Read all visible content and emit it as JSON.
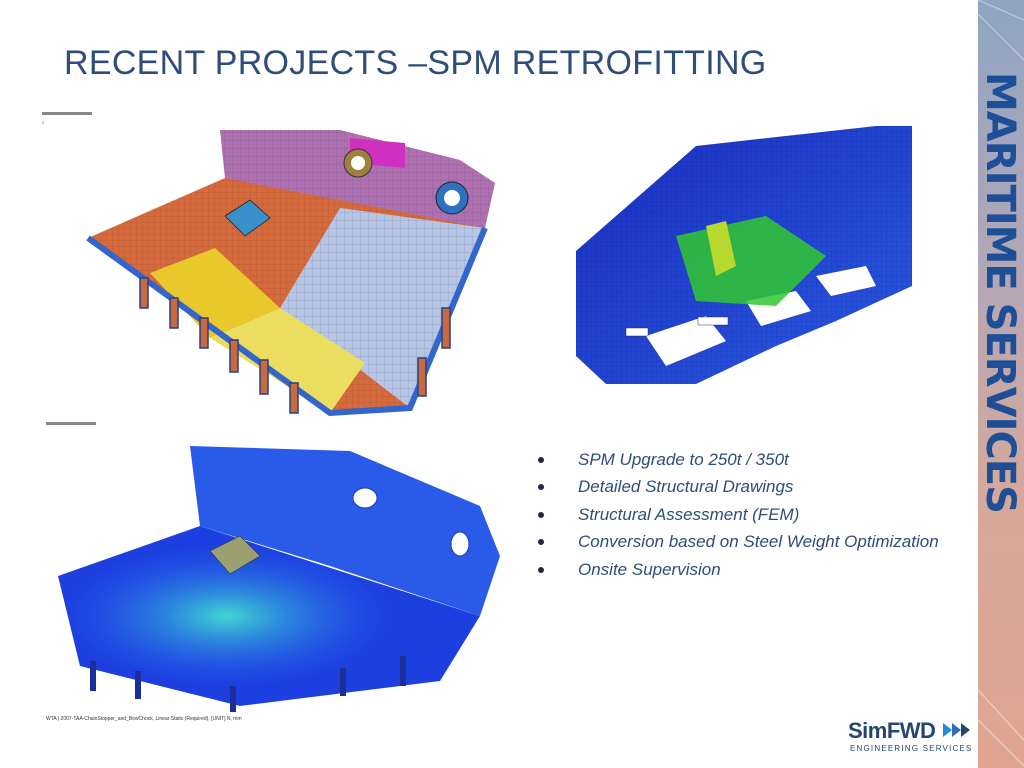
{
  "slide": {
    "title": "RECENT PROJECTS –SPM RETROFITTING",
    "side_text": "MARITIME SERVICES",
    "bullets": [
      "SPM Upgrade to 250t / 350t",
      "Detailed Structural Drawings",
      "Structural Assessment (FEM)",
      "Conversion based on Steel Weight Optimization",
      "Onsite Supervision"
    ],
    "fem_caption": "WTA | 2007-TAA-ChainStopper_and_BowChock, Linear Static (Required), [UNIT] N, mm",
    "logo": {
      "name": "SimFWD",
      "tagline": "ENGINEERING SERVICES"
    }
  },
  "colors": {
    "title": "#2e4d7a",
    "side_text": "#1e4f96",
    "side_panel_top": "#8fa5c2",
    "side_panel_bottom": "#e0a591",
    "bullet_text": "#2e4d7a"
  },
  "figures": [
    {
      "name": "fem-mesh-model-colored-plates"
    },
    {
      "name": "fem-stress-contour-bow-frames"
    },
    {
      "name": "fem-stress-contour-deck-model"
    }
  ]
}
